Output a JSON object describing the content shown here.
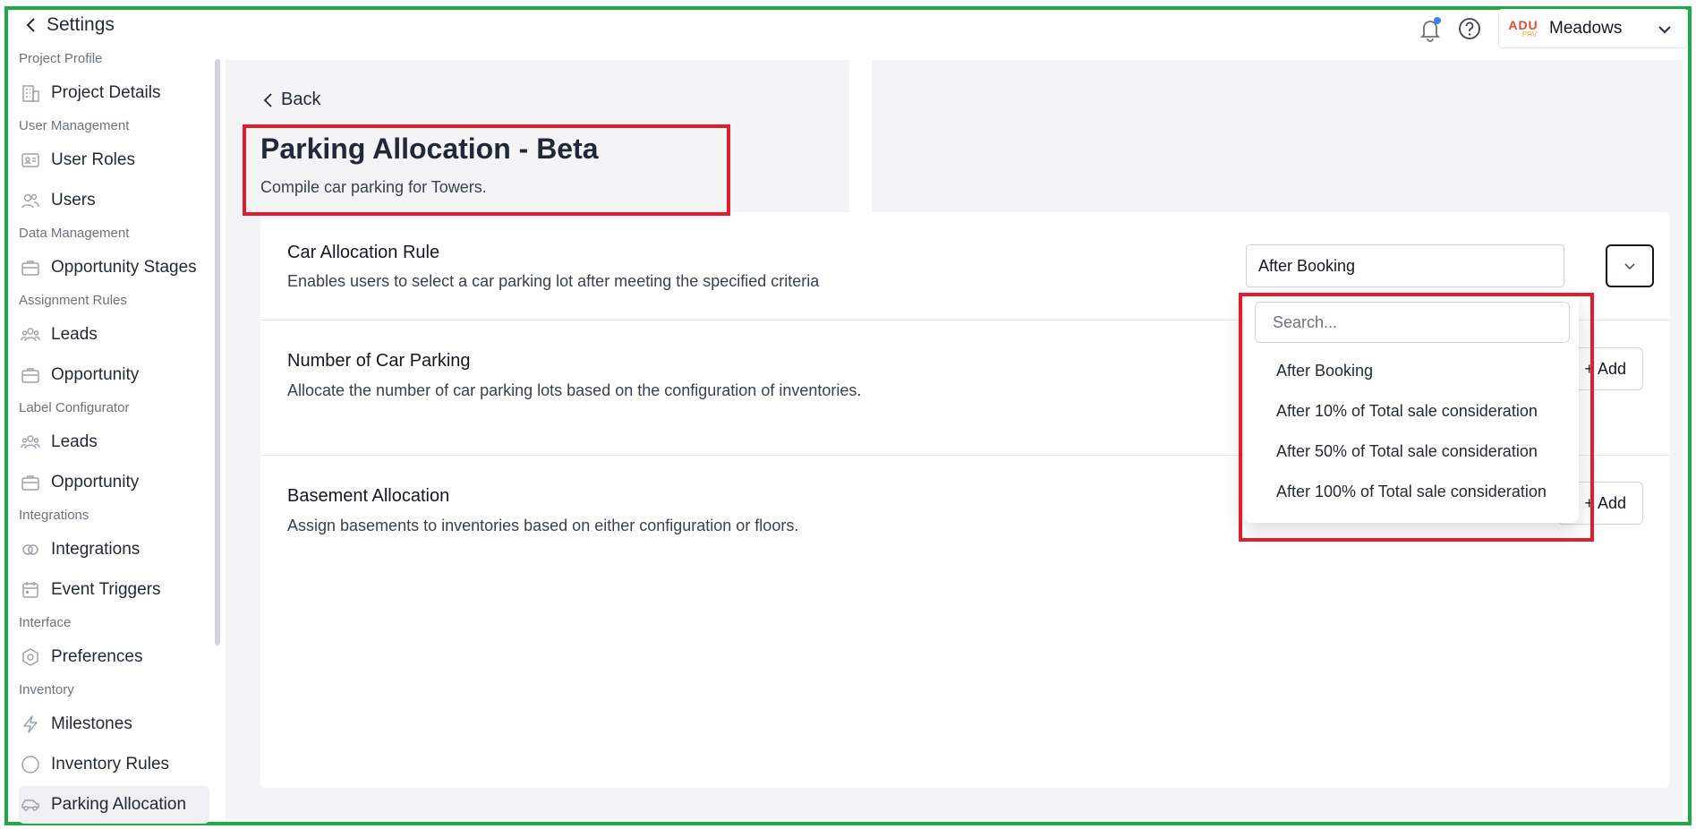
{
  "header": {
    "title": "Settings",
    "project_name": "Meadows",
    "project_logo_text": "ADU",
    "project_logo_subtext": "PRV"
  },
  "sidebar": {
    "sections": [
      "Project Profile",
      "User Management",
      "Data Management",
      "Assignment Rules",
      "Label Configurator",
      "Integrations",
      "Interface",
      "Inventory"
    ],
    "items": [
      {
        "label": "Project Details",
        "icon": "building-icon"
      },
      {
        "label": "User Roles",
        "icon": "id-card-icon"
      },
      {
        "label": "Users",
        "icon": "users-icon"
      },
      {
        "label": "Opportunity Stages",
        "icon": "briefcase-icon"
      },
      {
        "label": "Leads",
        "icon": "group-icon"
      },
      {
        "label": "Opportunity",
        "icon": "briefcase-icon"
      },
      {
        "label": "Leads",
        "icon": "group-icon"
      },
      {
        "label": "Opportunity",
        "icon": "briefcase-icon"
      },
      {
        "label": "Integrations",
        "icon": "link-icon"
      },
      {
        "label": "Event Triggers",
        "icon": "calendar-icon"
      },
      {
        "label": "Preferences",
        "icon": "hexagon-settings-icon"
      },
      {
        "label": "Milestones",
        "icon": "lightning-icon"
      },
      {
        "label": "Inventory Rules",
        "icon": "circle-icon"
      },
      {
        "label": "Parking Allocation",
        "icon": "car-icon",
        "active": true
      }
    ]
  },
  "main": {
    "back_label": "Back",
    "title": "Parking Allocation - Beta",
    "subtitle": "Compile car parking for Towers.",
    "rows": [
      {
        "title": "Car Allocation Rule",
        "description": "Enables users to select a car parking lot after meeting the specified criteria",
        "selected_value": "After Booking"
      },
      {
        "title": "Number of Car Parking",
        "description": "Allocate the number of car parking lots based on the configuration of inventories.",
        "button_label": "+ Add"
      },
      {
        "title": "Basement Allocation",
        "description": "Assign basements to inventories based on either configuration or floors.",
        "button_label": "+ Add"
      }
    ]
  },
  "dropdown": {
    "search_placeholder": "Search...",
    "options": [
      "After Booking",
      "After 10% of Total sale consideration",
      "After 50% of Total sale consideration",
      "After 100% of Total sale consideration"
    ]
  },
  "colors": {
    "highlight": "#e11d2e",
    "frame": "#22a846",
    "main_bg": "#f3f4f6",
    "active_nav": "#eef0f3"
  }
}
